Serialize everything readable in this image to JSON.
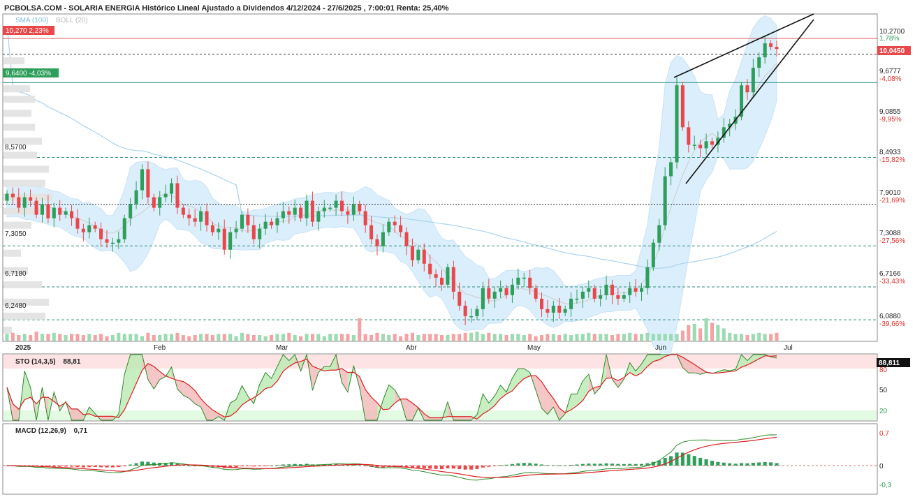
{
  "header": {
    "title": "PCBOLSA.COM - SOLARIA ENERGIA Histórico Lineal Ajustado a Dividendos 4/12/2024 - 27/6/2025 , 7:00:01 Renta: 25,40%",
    "legend_sma": "SMA (100)",
    "legend_boll": "BOLL (20)"
  },
  "colors": {
    "up": "#2e9e5b",
    "down": "#e9484a",
    "band": "#dbeefb",
    "sma": "#a9d2ee",
    "top": "#e06060",
    "mid": "#2f8f7f"
  },
  "chart_data": {
    "type": "candlestick",
    "ylim": [
      5.95,
      10.62
    ],
    "x_labels": [
      "2025",
      "Feb",
      "Mar",
      "Abr",
      "May",
      "Jun",
      "Jul"
    ],
    "right_ticks": [
      {
        "value": 10.27,
        "label": "10,2700",
        "pct": "1,78%"
      },
      {
        "value": 9.6777,
        "label": "9,6777",
        "pct": "-4,08%"
      },
      {
        "value": 9.0855,
        "label": "9,0855",
        "pct": "-9,95%"
      },
      {
        "value": 8.4933,
        "label": "8,4933",
        "pct": "-15,82%"
      },
      {
        "value": 7.901,
        "label": "7,9010",
        "pct": "-21,69%"
      },
      {
        "value": 7.3088,
        "label": "7,3088",
        "pct": "-27,56%"
      },
      {
        "value": 6.7166,
        "label": "6,7166",
        "pct": "-33,43%"
      },
      {
        "value": 6.088,
        "label": "6,0880",
        "pct": "-39,66%"
      }
    ],
    "last_price": {
      "value": 10.045,
      "label": "10,0450"
    },
    "top_marker": {
      "value": 10.27,
      "label": "10,270",
      "pct": "2,23%"
    },
    "bottom_marker": {
      "value": 9.64,
      "label": "9,6400",
      "pct": "-4,03%"
    },
    "support_levels": [
      {
        "value": 8.57,
        "label": "8,5700"
      },
      {
        "value": 7.305,
        "label": "7,3050"
      },
      {
        "value": 6.718,
        "label": "6,7180"
      },
      {
        "value": 6.248,
        "label": "6,2480"
      }
    ],
    "closes": [
      8.05,
      8.0,
      7.85,
      8.0,
      7.95,
      7.75,
      7.9,
      7.7,
      7.85,
      7.75,
      7.8,
      7.7,
      7.55,
      7.5,
      7.6,
      7.55,
      7.4,
      7.35,
      7.35,
      7.4,
      7.7,
      7.9,
      8.1,
      8.4,
      8.0,
      7.85,
      8.0,
      8.05,
      8.2,
      7.85,
      7.75,
      7.7,
      7.65,
      7.8,
      7.6,
      7.5,
      7.55,
      7.25,
      7.5,
      7.55,
      7.75,
      7.6,
      7.4,
      7.55,
      7.65,
      7.6,
      7.7,
      7.8,
      7.75,
      7.85,
      7.7,
      7.95,
      7.65,
      7.8,
      7.85,
      7.85,
      7.95,
      7.8,
      7.75,
      7.9,
      7.8,
      7.6,
      7.4,
      7.3,
      7.5,
      7.65,
      7.6,
      7.5,
      7.3,
      7.1,
      7.25,
      7.05,
      6.9,
      6.85,
      6.75,
      7.0,
      6.65,
      6.45,
      6.3,
      6.3,
      6.4,
      6.7,
      6.55,
      6.65,
      6.7,
      6.6,
      6.75,
      6.85,
      6.85,
      6.7,
      6.55,
      6.4,
      6.35,
      6.45,
      6.35,
      6.4,
      6.55,
      6.55,
      6.65,
      6.7,
      6.55,
      6.6,
      6.75,
      6.6,
      6.55,
      6.6,
      6.7,
      6.65,
      6.7,
      7.0,
      7.35,
      7.6,
      8.3,
      8.5,
      9.6,
      9.0,
      8.75,
      8.75,
      8.7,
      8.8,
      8.75,
      8.85,
      9.0,
      9.05,
      9.15,
      9.6,
      9.5,
      9.85,
      10.0,
      10.2,
      10.15,
      10.12
    ],
    "volume_rel": [
      0.3,
      0.35,
      0.25,
      0.3,
      0.25,
      0.4,
      0.3,
      0.3,
      0.35,
      0.3,
      0.25,
      0.3,
      0.3,
      0.25,
      0.3,
      0.25,
      0.3,
      0.2,
      0.25,
      0.35,
      0.3,
      0.3,
      0.3,
      0.2,
      0.35,
      0.25,
      0.25,
      0.3,
      0.3,
      0.35,
      0.25,
      0.2,
      0.25,
      0.3,
      0.3,
      0.25,
      0.3,
      0.3,
      0.3,
      0.2,
      0.35,
      0.3,
      0.25,
      0.25,
      0.2,
      0.25,
      0.3,
      0.3,
      0.35,
      0.25,
      0.2,
      0.3,
      0.3,
      0.3,
      0.2,
      0.3,
      0.3,
      0.3,
      0.3,
      0.25,
      1.0,
      0.3,
      0.25,
      0.35,
      0.3,
      0.25,
      0.3,
      0.2,
      0.3,
      0.35,
      0.25,
      0.3,
      0.3,
      0.3,
      0.25,
      0.25,
      0.3,
      0.3,
      0.35,
      0.35,
      0.4,
      0.3,
      0.35,
      0.3,
      0.3,
      0.25,
      0.3,
      0.3,
      0.25,
      0.3,
      0.2,
      0.25,
      0.3,
      0.3,
      0.25,
      0.3,
      0.25,
      0.3,
      0.3,
      0.35,
      0.3,
      0.3,
      0.3,
      0.25,
      0.3,
      0.3,
      0.35,
      0.3,
      0.3,
      0.35,
      0.3,
      0.3,
      0.3,
      0.3,
      0.3,
      0.45,
      0.7,
      0.75,
      0.55,
      1.0,
      0.8,
      0.7,
      0.55,
      0.35,
      0.3,
      0.3,
      0.25,
      0.3,
      0.35,
      0.3,
      0.3,
      0.35,
      0.4,
      0.3,
      0.3,
      0.35,
      0.4,
      0.35,
      0.35,
      0.45
    ]
  },
  "sto": {
    "label": "STO (14,3,5)",
    "value": "88,81",
    "box": "88,811",
    "levels": [
      "80",
      "50",
      "20"
    ]
  },
  "macd": {
    "label": "MACD (12,26,9)",
    "value": "0,71",
    "ticks": [
      "0,7",
      "0",
      "-0,3"
    ]
  }
}
